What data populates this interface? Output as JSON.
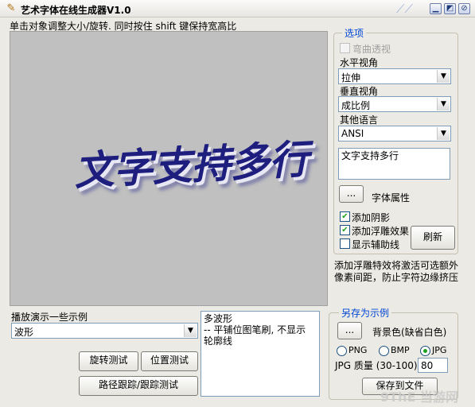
{
  "window": {
    "title": "艺术字体在线生成器V1.0",
    "minimize": "▁",
    "maximize": "◩",
    "close": "⊘"
  },
  "hint": "单击对象调整大小/旋转.  同时按住 shift 键保持宽高比",
  "canvas": {
    "art_text": "文字支持多行"
  },
  "options": {
    "legend": "选项",
    "curve_label": "弯曲透视",
    "horizontal_label": "水平视角",
    "horizontal_value": "拉伸",
    "vertical_label": "垂直视角",
    "vertical_value": "成比例",
    "language_label": "其他语言",
    "language_value": "ANSI",
    "text_value": "文字支持多行",
    "font_button": "...",
    "font_label": "字体属性",
    "shadow_label": "添加阴影",
    "emboss_label": "添加浮雕效果",
    "guides_label": "显示辅助线",
    "refresh_button": "刷新",
    "note_line1": "添加浮雕特效将激活可选额外",
    "note_line2": "像素间距，防止字符边缘挤压"
  },
  "demo": {
    "label": "播放演示一些示例",
    "selected": "波形",
    "description_line1": "多波形",
    "description_line2": " -- 平铺位图笔刷, 不显示",
    "description_line3": "轮廓线",
    "rotate_button": "旋转测试",
    "position_button": "位置测试",
    "path_button": "路径跟踪/跟踪测试"
  },
  "save": {
    "legend": "另存为示例",
    "bg_button": "...",
    "bg_label": "背景色(缺省白色)",
    "png_label": "PNG",
    "bmp_label": "BMP",
    "jpg_label": "JPG",
    "jpg_quality_label": "JPG 质量 (30-100)",
    "jpg_quality_value": "80",
    "save_button": "保存到文件"
  },
  "colors": {
    "accent_legend": "#0046d5",
    "check_mark": "#21a121",
    "canvas_bg": "#c0c0c0",
    "art_text": "#1e1e7e"
  },
  "watermark": "9ThE 当游网"
}
